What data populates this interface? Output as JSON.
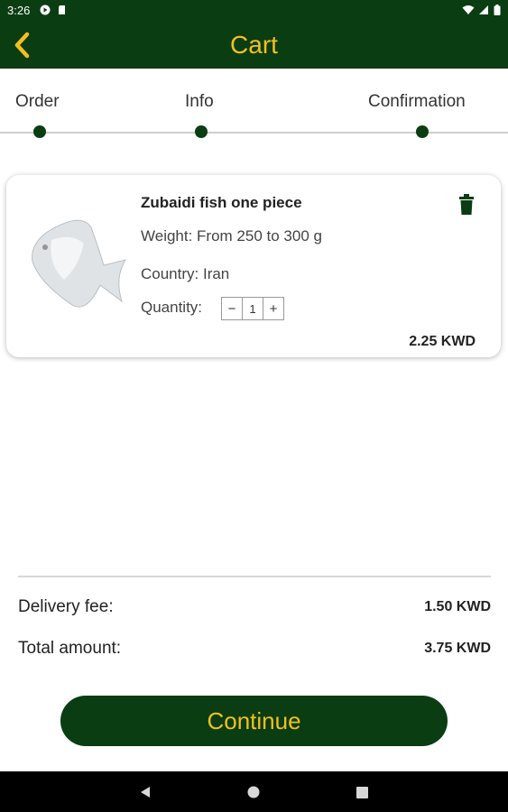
{
  "status_bar": {
    "time": "3:26",
    "left_icons": [
      "media-icon",
      "sd-card-icon"
    ],
    "right_icons": [
      "wifi-icon",
      "signal-icon",
      "battery-icon"
    ]
  },
  "header": {
    "title": "Cart",
    "back_icon": "chevron-left-icon",
    "background_color": "#0b3d12",
    "accent_color": "#f2c01e"
  },
  "steps": [
    {
      "label": "Order"
    },
    {
      "label": "Info"
    },
    {
      "label": "Confirmation"
    }
  ],
  "cart_item": {
    "name": "Zubaidi fish one piece",
    "weight": "Weight: From 250 to 300 g",
    "country": "Country: Iran",
    "quantity_label": "Quantity:",
    "quantity": "1",
    "decrease": "−",
    "increase": "+",
    "price": "2.25 KWD",
    "delete_icon": "trash-icon",
    "image_icon": "fish-image"
  },
  "summary": {
    "delivery_label": "Delivery fee:",
    "delivery_value": "1.50 KWD",
    "total_label": "Total amount:",
    "total_value": "3.75 KWD"
  },
  "continue_label": "Continue",
  "nav_bar": {
    "icons": [
      "back-icon",
      "home-icon",
      "recents-icon"
    ]
  }
}
